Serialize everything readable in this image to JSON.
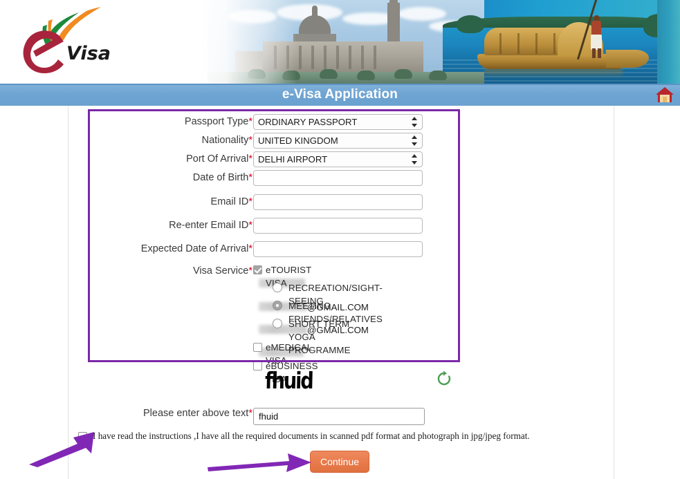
{
  "header": {
    "logo_text_e": "e",
    "logo_text_visa": "Visa",
    "title": "e-Visa Application",
    "home_icon": "home-icon"
  },
  "form": {
    "fields": [
      {
        "label": "Passport Type",
        "required": true,
        "type": "select",
        "value": "ORDINARY PASSPORT"
      },
      {
        "label": "Nationality",
        "required": true,
        "type": "select",
        "value": "UNITED KINGDOM"
      },
      {
        "label": "Port Of Arrival",
        "required": true,
        "type": "select",
        "value": "DELHI AIRPORT"
      },
      {
        "label": "Date of Birth",
        "required": true,
        "type": "text",
        "value": "",
        "redacted": true
      },
      {
        "label": "Email ID",
        "required": true,
        "type": "text",
        "value": "@GMAIL.COM",
        "redacted": true
      },
      {
        "label": "Re-enter Email ID",
        "required": true,
        "type": "text",
        "value": "@GMAIL.COM",
        "redacted": true
      },
      {
        "label": "Expected Date of Arrival",
        "required": true,
        "type": "text",
        "value": "",
        "redacted": true
      }
    ],
    "visa_service": {
      "label": "Visa Service",
      "required": true,
      "options": [
        {
          "label": "eTOURIST VISA",
          "type": "checkbox",
          "checked": true
        },
        {
          "label": "RECREATION/SIGHT-SEEING",
          "type": "radio",
          "checked": false
        },
        {
          "label": "MEETING FRIENDS/RELATIVES",
          "type": "radio",
          "checked": true
        },
        {
          "label": "SHORT TERM YOGA PROGRAMME",
          "type": "radio",
          "checked": false
        },
        {
          "label": "eMEDICAL VISA",
          "type": "checkbox",
          "checked": false
        },
        {
          "label": "eBUSINESS VISA",
          "type": "checkbox",
          "checked": false
        }
      ]
    },
    "captcha": {
      "image_text": "fhuid",
      "refresh_icon": "refresh-icon",
      "label": "Please enter above text",
      "required": true,
      "input_value": "fhuid",
      "placeholder": ""
    },
    "instructions": {
      "text": "I have read the instructions ,I have all the required documents in scanned pdf format and photograph in jpg/jpeg format.",
      "checked": false
    },
    "continue_label": "Continue"
  },
  "colors": {
    "titlebar": "#6ea4d2",
    "annotation": "#7b28a8",
    "continue_button": "#e87a4b",
    "required_asterisk": "#d0021b",
    "refresh_icon": "#4a9e52"
  }
}
